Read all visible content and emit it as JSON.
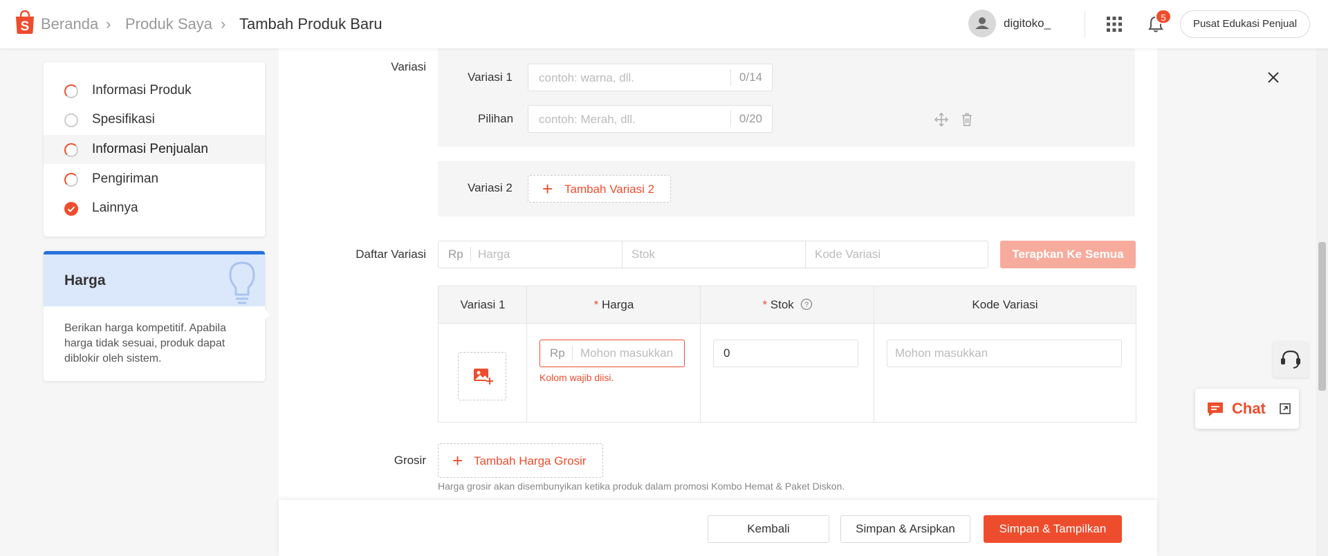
{
  "header": {
    "breadcrumb": [
      "Beranda",
      "Produk Saya",
      "Tambah Produk Baru"
    ],
    "username": "digitoko_",
    "notification_count": "5",
    "edu_button": "Pusat Edukasi Penjual",
    "brand_color": "#ee4d2d"
  },
  "steps": [
    {
      "label": "Informasi Produk",
      "state": "partial"
    },
    {
      "label": "Spesifikasi",
      "state": "empty"
    },
    {
      "label": "Informasi Penjualan",
      "state": "partial",
      "active": true
    },
    {
      "label": "Pengiriman",
      "state": "partial"
    },
    {
      "label": "Lainnya",
      "state": "done"
    }
  ],
  "tip": {
    "title": "Harga",
    "text": "Berikan harga kompetitif. Apabila harga tidak sesuai, produk dapat diblokir oleh sistem."
  },
  "variation": {
    "section_label": "Variasi",
    "var1_label": "Variasi 1",
    "var1_placeholder": "contoh: warna, dll.",
    "var1_count": "0/14",
    "option_label": "Pilihan",
    "option_placeholder": "contoh: Merah, dll.",
    "option_count": "0/20",
    "var2_label": "Variasi 2",
    "add_var2": "Tambah Variasi 2"
  },
  "variation_list": {
    "label": "Daftar Variasi",
    "currency": "Rp",
    "price_placeholder": "Harga",
    "stock_placeholder": "Stok",
    "code_placeholder": "Kode Variasi",
    "apply_all": "Terapkan Ke Semua",
    "table": {
      "headers": [
        "Variasi 1",
        "Harga",
        "Stok",
        "Kode Variasi"
      ],
      "row": {
        "currency": "Rp",
        "price_placeholder": "Mohon masukkan",
        "price_error": "Kolom wajib diisi.",
        "stock_value": "0",
        "code_placeholder": "Mohon masukkan"
      }
    }
  },
  "wholesale": {
    "label": "Grosir",
    "add_button": "Tambah Harga Grosir",
    "note": "Harga grosir akan disembunyikan ketika produk dalam promosi Kombo Hemat & Paket Diskon."
  },
  "footer": {
    "back": "Kembali",
    "save_archive": "Simpan & Arsipkan",
    "save_publish": "Simpan & Tampilkan"
  },
  "chat": {
    "label": "Chat"
  }
}
